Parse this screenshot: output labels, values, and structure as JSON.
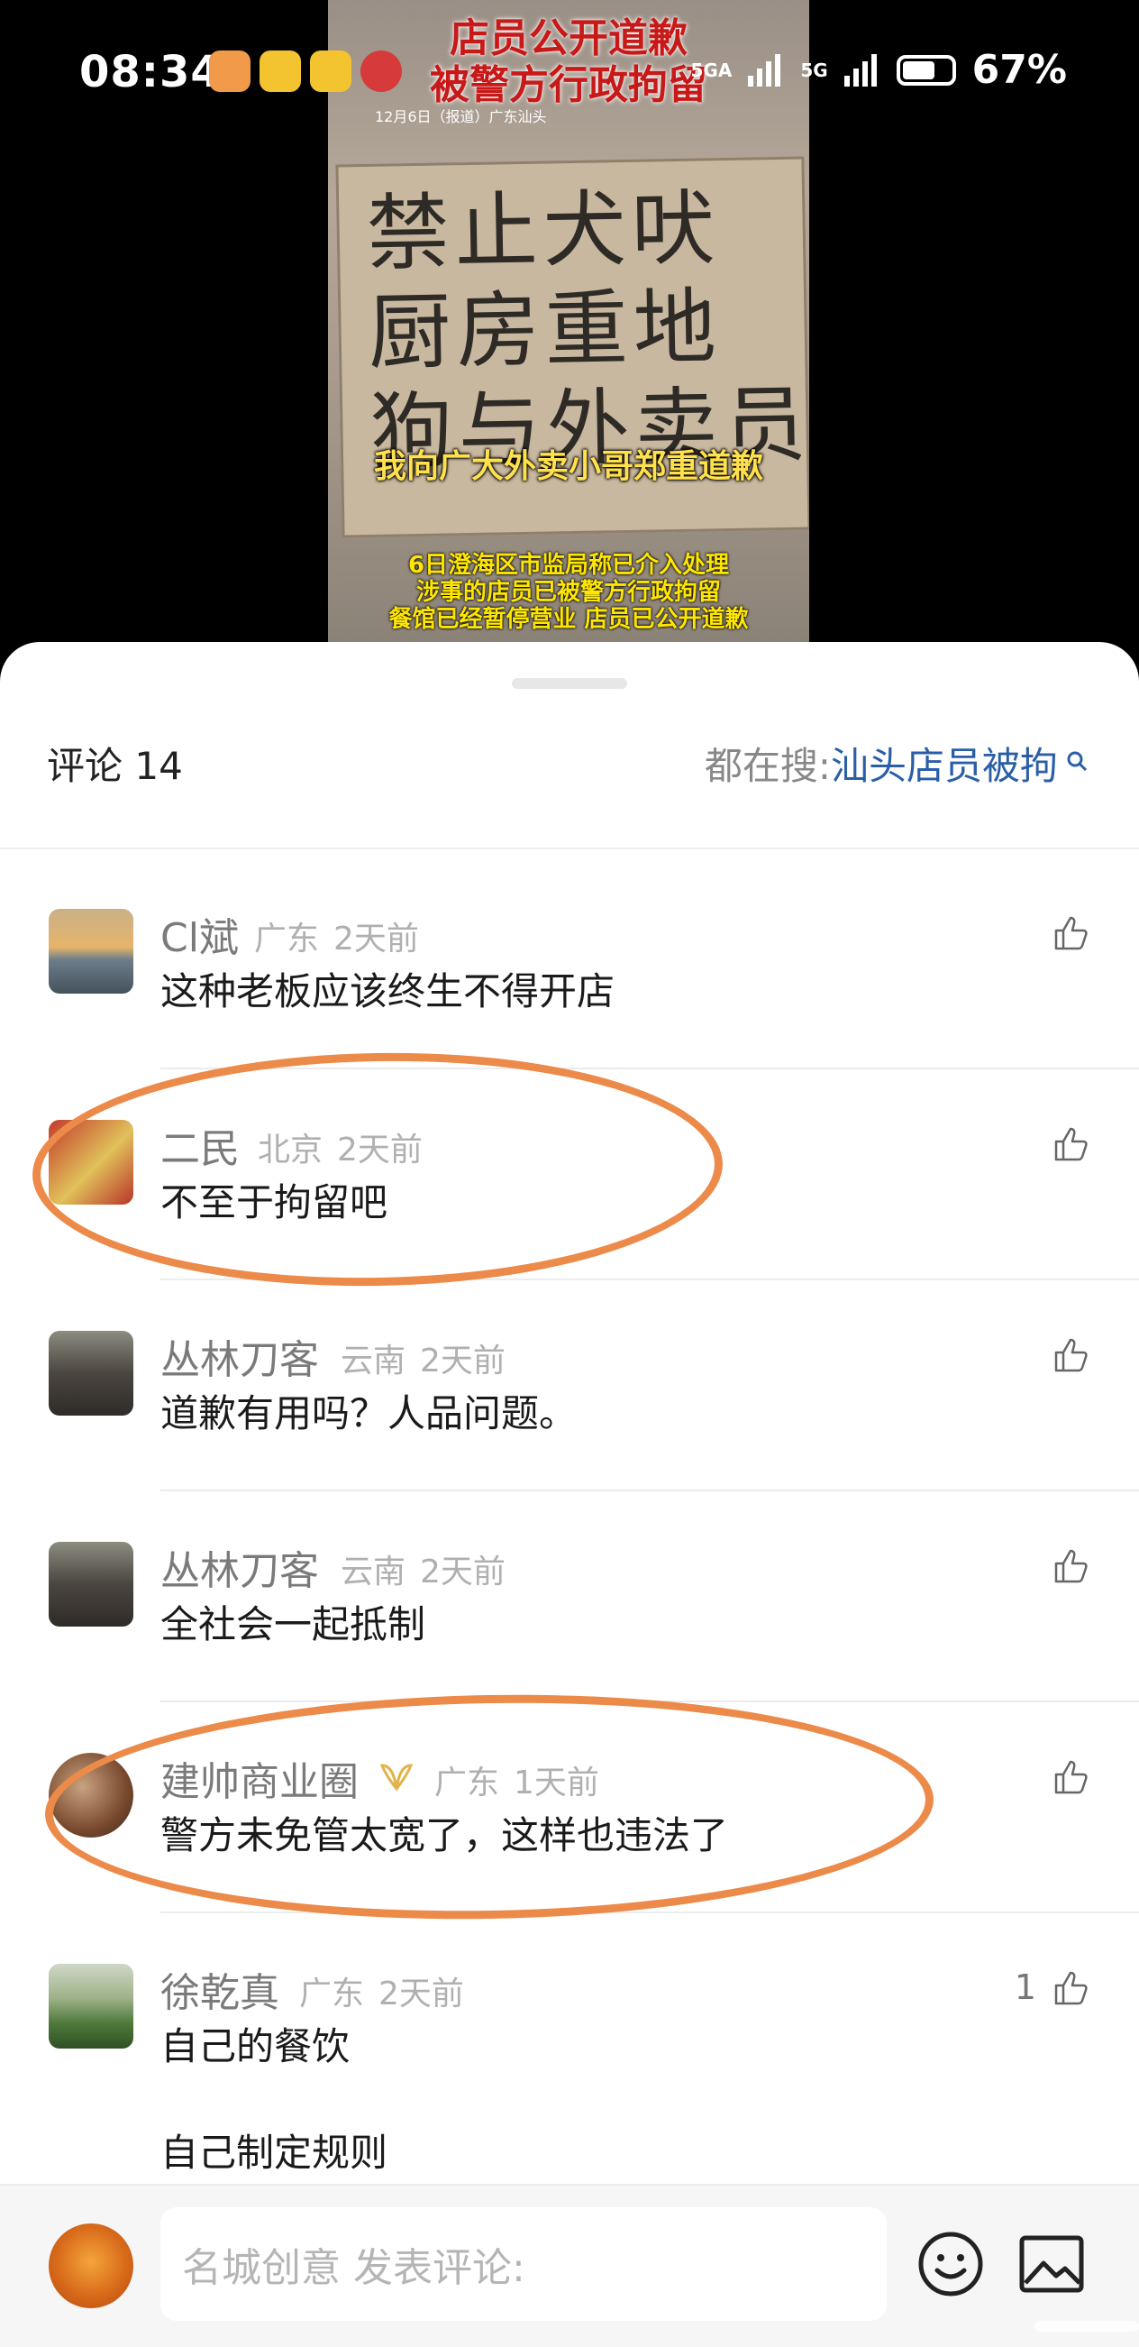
{
  "status_bar": {
    "time": "08:34",
    "network_1": "5GA",
    "network_2": "5G",
    "battery_text": "67%",
    "battery_level": 0.67
  },
  "video": {
    "headline_line1": "店员公开道歉",
    "headline_line2": "被警方行政拘留",
    "dateline": "12月6日（报道）广东汕头",
    "sign_text": "禁止犬吠\n厨房重地\n狗与外卖员",
    "caption": "我向广大外卖小哥郑重道歉",
    "subtitle_line1": "6日澄海区市监局称已介入处理",
    "subtitle_line2": "涉事的店员已被警方行政拘留",
    "subtitle_line3": "餐馆已经暂停营业 店员已公开道歉"
  },
  "header": {
    "comment_count": "评论 14",
    "trending_prefix": "都在搜: ",
    "trending_term": "汕头店员被拘"
  },
  "comments": [
    {
      "name": "Cl斌",
      "location": "广东",
      "time": "2天前",
      "text": "这种老板应该终生不得开店"
    },
    {
      "name": "二民",
      "location": "北京",
      "time": "2天前",
      "text": "不至于拘留吧"
    },
    {
      "name": "丛林刀客",
      "location": "云南",
      "time": "2天前",
      "text": "道歉有用吗？人品问题。"
    },
    {
      "name": "丛林刀客",
      "location": "云南",
      "time": "2天前",
      "text": "全社会一起抵制"
    },
    {
      "name": "建帅商业圈",
      "location": "广东",
      "time": "1天前",
      "text": "警方未免管太宽了，这样也违法了"
    },
    {
      "name": "徐乾真",
      "location": "广东",
      "time": "2天前",
      "text": "自己的餐饮",
      "text2": "自己制定规则",
      "likes": "1"
    }
  ],
  "bottom_bar": {
    "input_placeholder": "名城创意 发表评论:"
  },
  "colors": {
    "accent_link": "#2a5fa8",
    "highlight_ellipse": "#ec8a4a"
  },
  "icons": [
    "search-icon",
    "like-icon",
    "emoji-icon",
    "image-icon",
    "vip-badge-icon"
  ]
}
